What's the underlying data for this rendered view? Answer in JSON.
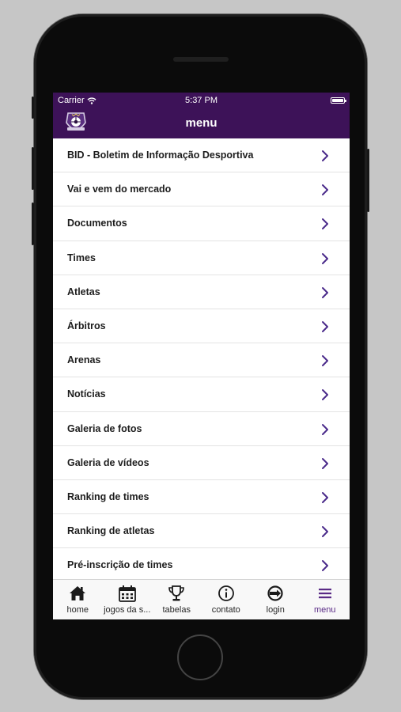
{
  "status_bar": {
    "carrier": "Carrier",
    "time": "5:37 PM"
  },
  "nav": {
    "title": "menu"
  },
  "menu_items": [
    {
      "label": "BID - Boletim de Informação Desportiva"
    },
    {
      "label": "Vai e vem do mercado"
    },
    {
      "label": "Documentos"
    },
    {
      "label": "Times"
    },
    {
      "label": "Atletas"
    },
    {
      "label": "Árbitros"
    },
    {
      "label": "Arenas"
    },
    {
      "label": "Notícias"
    },
    {
      "label": "Galeria de fotos"
    },
    {
      "label": "Galeria de vídeos"
    },
    {
      "label": "Ranking de times"
    },
    {
      "label": "Ranking de atletas"
    },
    {
      "label": "Pré-inscrição de times"
    }
  ],
  "tabs": [
    {
      "label": "home",
      "icon": "home-icon"
    },
    {
      "label": "jogos da s...",
      "icon": "calendar-icon"
    },
    {
      "label": "tabelas",
      "icon": "trophy-icon"
    },
    {
      "label": "contato",
      "icon": "info-icon"
    },
    {
      "label": "login",
      "icon": "login-icon"
    },
    {
      "label": "menu",
      "icon": "menu-icon",
      "active": true
    }
  ],
  "colors": {
    "header": "#3d1258",
    "accent": "#5a2b86",
    "chevron": "#4a2a8a",
    "background": "#c6c6c6"
  }
}
